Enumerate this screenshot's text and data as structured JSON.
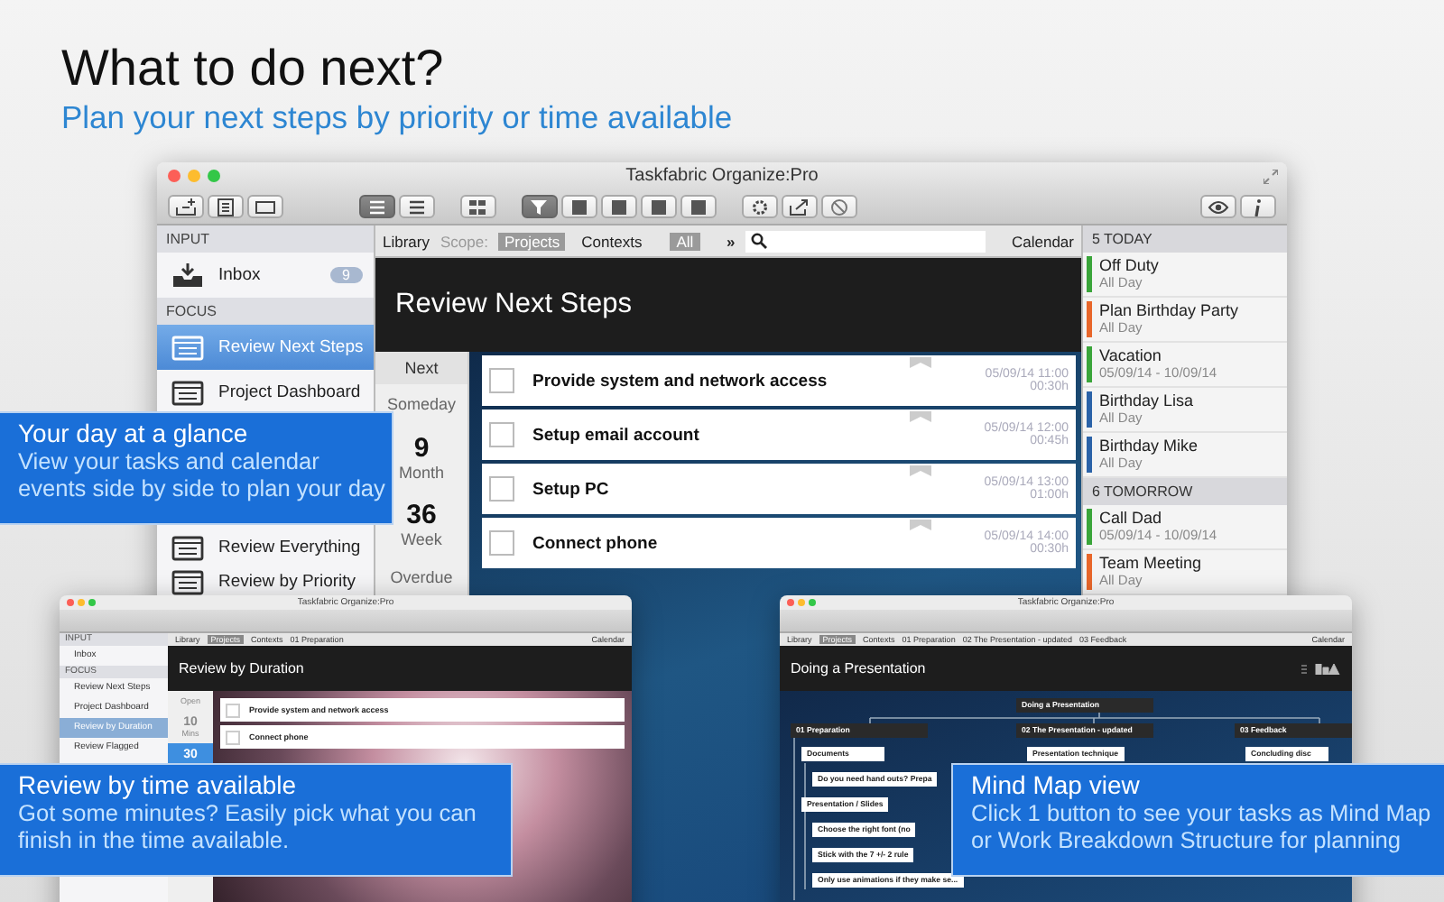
{
  "hero": {
    "title": "What to do next?",
    "subtitle": "Plan your next steps by priority or time available"
  },
  "main_window": {
    "title": "Taskfabric Organize:Pro",
    "toolbar_groups": [
      [
        {
          "selected": false
        },
        {
          "selected": false
        },
        {
          "selected": false
        }
      ],
      [
        {
          "selected": true
        },
        {
          "selected": false
        }
      ],
      [
        {
          "selected": false
        }
      ],
      [
        {
          "selected": true
        },
        {
          "selected": false
        },
        {
          "selected": false
        },
        {
          "selected": false
        },
        {
          "selected": false
        }
      ],
      [
        {
          "selected": false
        },
        {
          "selected": false
        },
        {
          "selected": false
        }
      ],
      [
        {
          "selected": false
        },
        {
          "selected": false
        }
      ]
    ],
    "sidebar": [
      {
        "header": "INPUT",
        "items": [
          {
            "label": "Inbox",
            "badge": "9",
            "selected": false
          }
        ]
      },
      {
        "header": "FOCUS",
        "items": [
          {
            "label": "Review Next Steps",
            "selected": true
          },
          {
            "label": "Project Dashboard",
            "selected": false
          },
          {
            "label": "Review Everything",
            "selected": false
          },
          {
            "label": "Review by Priority",
            "selected": false
          }
        ]
      }
    ],
    "scope_bar": {
      "library": "Library",
      "scope_label": "Scope:",
      "scopes": [
        {
          "label": "Projects",
          "selected": true
        },
        {
          "label": "Contexts",
          "selected": false
        }
      ],
      "filter": "All",
      "more": "»",
      "calendar": "Calendar"
    },
    "header": "Review Next Steps",
    "periods": [
      {
        "kind": "nav",
        "label": "Next"
      },
      {
        "kind": "plain",
        "label": "Someday"
      },
      {
        "kind": "count",
        "count": "9",
        "label": "Month"
      },
      {
        "kind": "count",
        "count": "36",
        "label": "Week"
      },
      {
        "kind": "plain",
        "label": "Overdue"
      }
    ],
    "tasks": [
      {
        "title": "Provide system and network access",
        "date": "05/09/14 11:00",
        "duration": "00:30h",
        "checked": false
      },
      {
        "title": "Setup email account",
        "date": "05/09/14 12:00",
        "duration": "00:45h",
        "checked": false
      },
      {
        "title": "Setup PC",
        "date": "05/09/14 13:00",
        "duration": "01:00h",
        "checked": false
      },
      {
        "title": "Connect phone",
        "date": "05/09/14 14:00",
        "duration": "00:30h",
        "checked": false
      }
    ],
    "calendar": [
      {
        "header": "5 TODAY",
        "events": [
          {
            "title": "Off Duty",
            "when": "All Day",
            "color": "#3aa53a"
          },
          {
            "title": "Plan Birthday Party",
            "when": "All Day",
            "color": "#e8662a"
          },
          {
            "title": "Vacation",
            "when": "05/09/14 - 10/09/14",
            "color": "#3aa53a"
          },
          {
            "title": "Birthday Lisa",
            "when": "All Day",
            "color": "#2a62a8"
          },
          {
            "title": "Birthday Mike",
            "when": "All Day",
            "color": "#2a62a8"
          }
        ]
      },
      {
        "header": "6 TOMORROW",
        "events": [
          {
            "title": "Call Dad",
            "when": "05/09/14 - 10/09/14",
            "color": "#3aa53a"
          },
          {
            "title": "Team Meeting",
            "when": "All Day",
            "color": "#e8662a"
          }
        ]
      }
    ]
  },
  "duration_window": {
    "title": "Taskfabric Organize:Pro",
    "library": "Library",
    "projects": "Projects",
    "contexts": "Contexts",
    "crumbs": [
      "01 Preparation"
    ],
    "calendar": "Calendar",
    "sidebar": [
      {
        "kind": "header",
        "label": "INPUT"
      },
      {
        "kind": "item",
        "label": "Inbox",
        "selected": false
      },
      {
        "kind": "header",
        "label": "FOCUS"
      },
      {
        "kind": "item",
        "label": "Review Next Steps",
        "selected": false
      },
      {
        "kind": "item",
        "label": "Project Dashboard",
        "selected": false
      },
      {
        "kind": "item",
        "label": "Review by Duration",
        "selected": true
      },
      {
        "kind": "item",
        "label": "Review Flagged",
        "selected": false
      }
    ],
    "header": "Review by Duration",
    "durations": [
      {
        "kind": "plain",
        "label": "Open",
        "selected": false
      },
      {
        "kind": "count",
        "count": "10",
        "label": "Mins",
        "selected": false
      },
      {
        "kind": "count",
        "count": "30",
        "selected": true
      }
    ],
    "tasks": [
      {
        "title": "Provide system and network access"
      },
      {
        "title": "Connect phone"
      }
    ]
  },
  "mindmap_window": {
    "title": "Taskfabric Organize:Pro",
    "library": "Library",
    "projects": "Projects",
    "contexts": "Contexts",
    "crumbs": [
      "01 Preparation",
      "02 The Presentation - updated",
      "03 Feedback"
    ],
    "calendar": "Calendar",
    "header": "Doing a Presentation",
    "root": "Doing a Presentation",
    "branches": [
      {
        "title": "01 Preparation",
        "children": [
          {
            "title": "Documents",
            "children": [
              {
                "title": "Do you need hand outs? Prepa"
              }
            ]
          },
          {
            "title": "Presentation / Slides",
            "children": [
              {
                "title": "Choose the right font (no"
              },
              {
                "title": "Stick with the 7 +/- 2 rule"
              },
              {
                "title": "Only use animations if they make se..."
              }
            ]
          }
        ]
      },
      {
        "title": "02 The Presentation - updated",
        "children": [
          {
            "title": "Presentation technique"
          }
        ]
      },
      {
        "title": "03 Feedback",
        "children": [
          {
            "title": "Concluding disc"
          }
        ]
      }
    ]
  },
  "callouts": [
    {
      "title": "Your day at a glance",
      "text": "View your tasks and calendar events side by side to plan your day"
    },
    {
      "title": "Review by time available",
      "text": "Got some minutes? Easily pick what you can finish in the time available."
    },
    {
      "title": "Mind Map view",
      "text": "Click 1 button to see your tasks as Mind Map or Work Breakdown Structure for planning"
    }
  ]
}
